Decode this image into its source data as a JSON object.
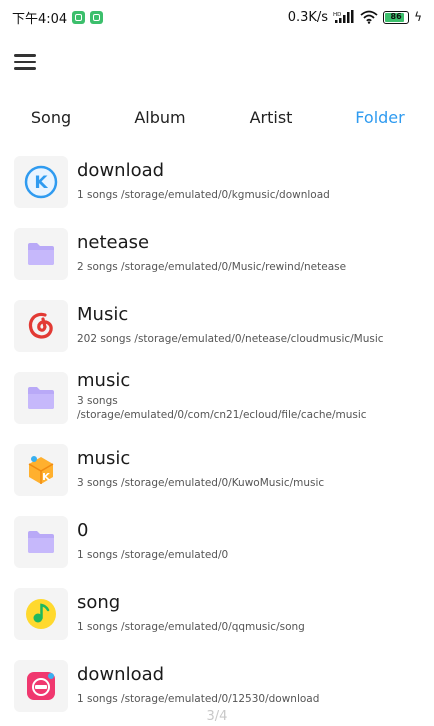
{
  "status_bar": {
    "time": "下午4:04",
    "net_speed": "0.3K/s",
    "battery_level": "86",
    "battery_fraction": 0.86,
    "battery_color": "#3cbf6c"
  },
  "header": {
    "menu_icon": "hamburger-menu-icon"
  },
  "tabs": [
    {
      "label": "Song",
      "active": false
    },
    {
      "label": "Album",
      "active": false
    },
    {
      "label": "Artist",
      "active": false
    },
    {
      "label": "Folder",
      "active": true
    }
  ],
  "accent_color": "#2f9bf0",
  "folders": [
    {
      "title": "download",
      "subtitle": "1 songs /storage/emulated/0/kgmusic/download",
      "icon": "kugou-app-icon"
    },
    {
      "title": "netease",
      "subtitle": "2 songs /storage/emulated/0/Music/rewind/netease",
      "icon": "folder-icon"
    },
    {
      "title": "Music",
      "subtitle": "202 songs /storage/emulated/0/netease/cloudmusic/Music",
      "icon": "netease-cloud-music-icon"
    },
    {
      "title": "music",
      "subtitle": "3 songs /storage/emulated/0/com/cn21/ecloud/file/cache/music",
      "icon": "folder-icon"
    },
    {
      "title": "music",
      "subtitle": "3 songs /storage/emulated/0/KuwoMusic/music",
      "icon": "kuwo-music-icon"
    },
    {
      "title": "0",
      "subtitle": "1 songs /storage/emulated/0",
      "icon": "folder-icon"
    },
    {
      "title": "song",
      "subtitle": "1 songs /storage/emulated/0/qqmusic/song",
      "icon": "qq-music-icon"
    },
    {
      "title": "download",
      "subtitle": "1 songs /storage/emulated/0/12530/download",
      "icon": "migu-music-icon"
    }
  ],
  "page_indicator": "3/4"
}
